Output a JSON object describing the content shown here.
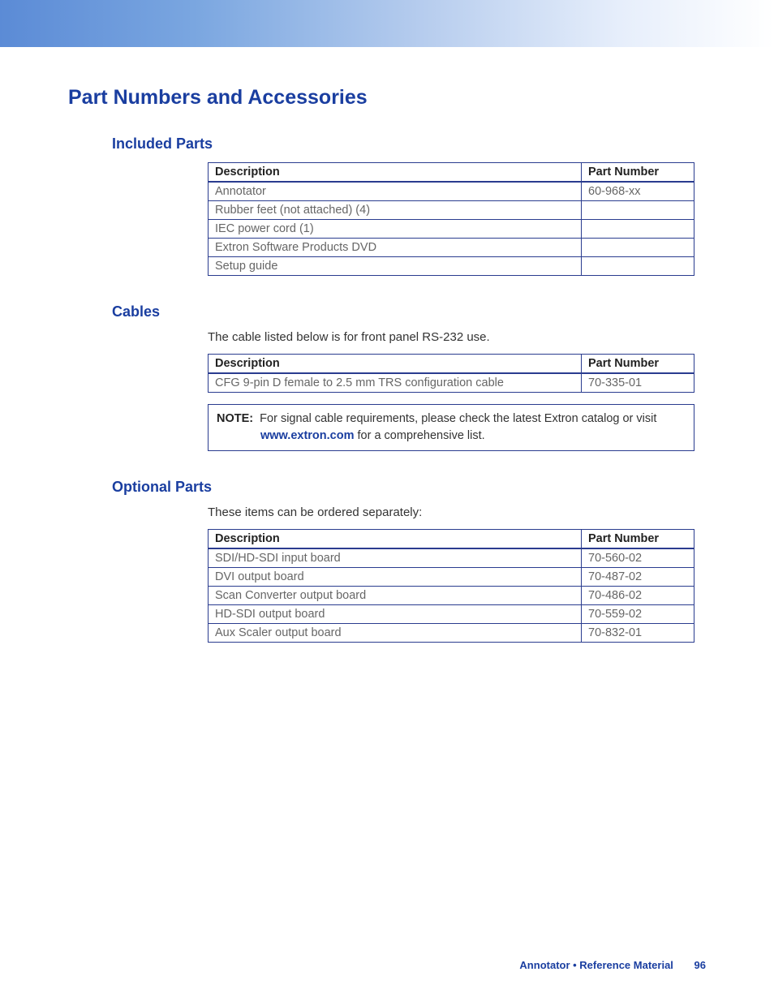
{
  "page_title": "Part Numbers and Accessories",
  "sections": {
    "included": {
      "heading": "Included Parts",
      "table": {
        "headers": {
          "description": "Description",
          "part_number": "Part Number"
        },
        "rows": [
          {
            "description": "Annotator",
            "part_number": "60-968-xx"
          },
          {
            "description": "Rubber feet (not attached) (4)",
            "part_number": ""
          },
          {
            "description": "IEC power cord (1)",
            "part_number": ""
          },
          {
            "description": "Extron Software Products DVD",
            "part_number": ""
          },
          {
            "description": "Setup guide",
            "part_number": ""
          }
        ]
      }
    },
    "cables": {
      "heading": "Cables",
      "intro": "The cable listed below is for front panel RS-232 use.",
      "table": {
        "headers": {
          "description": "Description",
          "part_number": "Part Number"
        },
        "rows": [
          {
            "description": "CFG 9-pin D female to 2.5 mm TRS configuration cable",
            "part_number": "70-335-01"
          }
        ]
      },
      "note": {
        "label": "NOTE:",
        "before_link": "For signal cable requirements, please check the latest Extron catalog or visit ",
        "link_text": "www.extron.com",
        "after_link": " for a comprehensive list."
      }
    },
    "optional": {
      "heading": "Optional Parts",
      "intro": "These items can be ordered separately:",
      "table": {
        "headers": {
          "description": "Description",
          "part_number": "Part Number"
        },
        "rows": [
          {
            "description": "SDI/HD-SDI input board",
            "part_number": "70-560-02"
          },
          {
            "description": "DVI output board",
            "part_number": "70-487-02"
          },
          {
            "description": "Scan Converter output board",
            "part_number": "70-486-02"
          },
          {
            "description": "HD-SDI output board",
            "part_number": "70-559-02"
          },
          {
            "description": "Aux Scaler output board",
            "part_number": "70-832-01"
          }
        ]
      }
    }
  },
  "footer": {
    "doc_section": "Annotator • Reference Material",
    "page_number": "96"
  }
}
